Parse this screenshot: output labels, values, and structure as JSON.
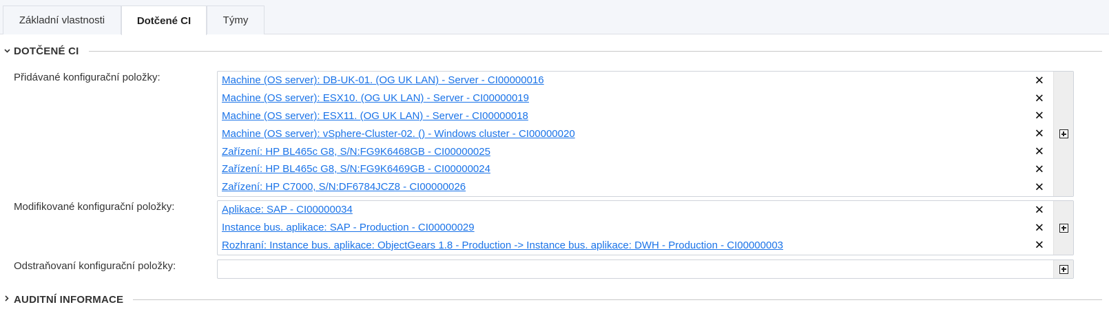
{
  "tabs": [
    {
      "label": "Základní vlastnosti"
    },
    {
      "label": "Dotčené CI",
      "active": true
    },
    {
      "label": "Týmy"
    }
  ],
  "sections": {
    "dotcene": {
      "title": "DOTČENÉ CI",
      "expanded": true
    },
    "auditni": {
      "title": "AUDITNÍ INFORMACE",
      "expanded": false
    }
  },
  "fields": {
    "added": {
      "label": "Přidávané konfigurační položky:",
      "items": [
        "Machine (OS server): DB-UK-01. (OG UK LAN) - Server - CI00000016",
        "Machine (OS server): ESX10. (OG UK LAN) - Server - CI00000019",
        "Machine (OS server): ESX11. (OG UK LAN) - Server - CI00000018",
        "Machine (OS server): vSphere-Cluster-02. () - Windows cluster - CI00000020",
        "Zařízení: HP BL465c G8, S/N:FG9K6468GB - CI00000025",
        "Zařízení: HP BL465c G8, S/N:FG9K6469GB - CI00000024",
        "Zařízení: HP C7000, S/N:DF6784JCZ8 - CI00000026"
      ]
    },
    "modified": {
      "label": "Modifikované konfigurační položky:",
      "items": [
        "Aplikace: SAP - CI00000034",
        "Instance bus. aplikace: SAP - Production - CI00000029",
        "Rozhraní: Instance bus. aplikace: ObjectGears 1.8 - Production -> Instance bus. aplikace: DWH - Production - CI00000003"
      ]
    },
    "removed": {
      "label": "Odstraňovaní konfigurační položky:",
      "items": []
    }
  },
  "icons": {
    "remove": "✕",
    "collapse": "chevron-down-icon",
    "expand": "chevron-right-icon",
    "add": "plus-square-icon"
  },
  "colors": {
    "link": "#1a73e8",
    "tabbar_bg": "#f4f6fa",
    "add_strip_bg": "#eeeeee"
  }
}
